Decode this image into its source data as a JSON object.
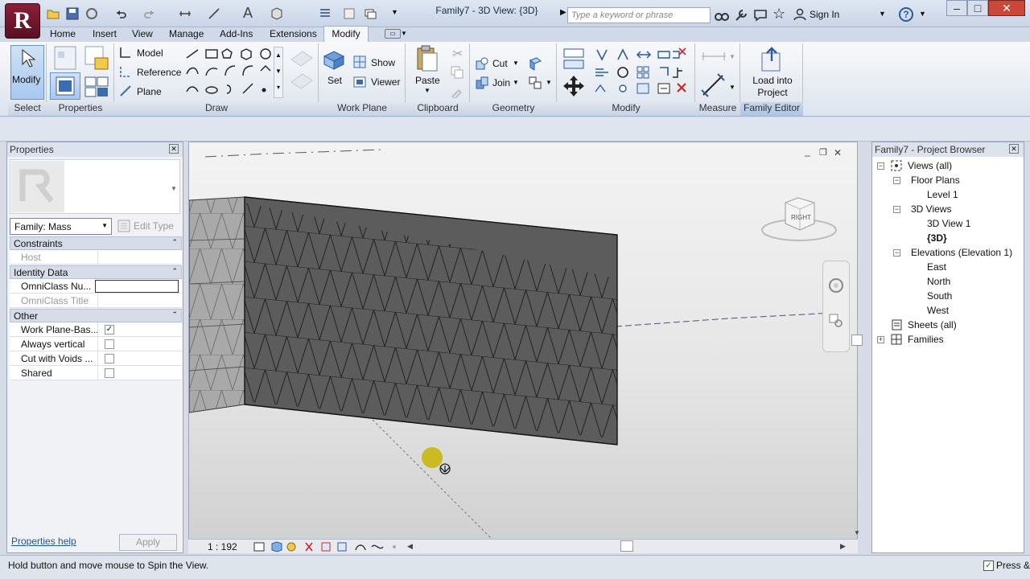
{
  "app": {
    "logo_letter": "R",
    "doc_title": "Family7 - 3D View: {3D}"
  },
  "search": {
    "placeholder": "Type a keyword or phrase"
  },
  "signin": {
    "label": "Sign In"
  },
  "tabs": [
    "Home",
    "Insert",
    "View",
    "Manage",
    "Add-Ins",
    "Extensions",
    "Modify"
  ],
  "ribbon": {
    "select": {
      "modify_label": "Modify",
      "panel": "Select"
    },
    "properties": {
      "panel": "Properties"
    },
    "draw": {
      "model": "Model",
      "reference": "Reference",
      "plane": "Plane",
      "panel": "Draw"
    },
    "workplane": {
      "set": "Set",
      "show": "Show",
      "viewer": "Viewer",
      "panel": "Work Plane"
    },
    "clipboard": {
      "paste": "Paste",
      "panel": "Clipboard"
    },
    "geometry": {
      "cut": "Cut",
      "join": "Join",
      "panel": "Geometry"
    },
    "modify": {
      "panel": "Modify"
    },
    "measure": {
      "panel": "Measure"
    },
    "family_editor": {
      "load_line1": "Load into",
      "load_line2": "Project",
      "panel": "Family Editor"
    }
  },
  "properties": {
    "title": "Properties",
    "family": "Family: Mass",
    "edit_type": "Edit Type",
    "categories": [
      {
        "name": "Constraints",
        "rows": [
          {
            "key": "Host",
            "disabled": true
          }
        ]
      },
      {
        "name": "Identity Data",
        "rows": [
          {
            "key": "OmniClass Nu..."
          },
          {
            "key": "OmniClass Title",
            "disabled": true
          }
        ]
      },
      {
        "name": "Other",
        "rows": [
          {
            "key": "Work Plane-Bas...",
            "checked": true
          },
          {
            "key": "Always vertical",
            "checked": false
          },
          {
            "key": "Cut with Voids ...",
            "checked": false
          },
          {
            "key": "Shared",
            "checked": false
          }
        ]
      }
    ],
    "help_link": "Properties help",
    "apply": "Apply"
  },
  "view": {
    "scale": "1 : 192",
    "viewcube_face": "RIGHT"
  },
  "browser": {
    "title": "Family7 - Project Browser",
    "nodes": {
      "views": "Views (all)",
      "floor_plans": "Floor Plans",
      "level1": "Level 1",
      "views3d": "3D Views",
      "view3d1": "3D View 1",
      "view3d": "{3D}",
      "elevations": "Elevations (Elevation 1)",
      "east": "East",
      "north": "North",
      "south": "South",
      "west": "West",
      "sheets": "Sheets (all)",
      "families": "Families"
    }
  },
  "status": {
    "text": "Hold button and move mouse to Spin the View.",
    "press": "Press &"
  },
  "colors": {
    "accent": "#3b6db3",
    "panel_label_bg": "#d3dbe8",
    "mass_face": "#5c5c5c",
    "mass_side": "#a9a9a9",
    "cursor_dot": "#c8b400"
  }
}
